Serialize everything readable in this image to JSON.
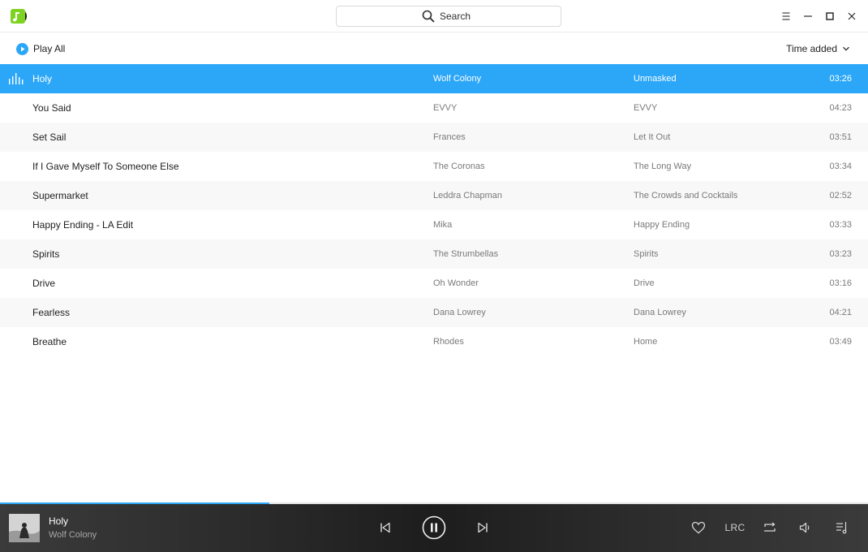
{
  "app": {
    "logo_icon": "music-note-logo-icon"
  },
  "search": {
    "placeholder": "Search",
    "icon": "search-icon"
  },
  "window_controls": [
    "menu-icon",
    "minimize-icon",
    "maximize-icon",
    "close-icon"
  ],
  "toolbar": {
    "play_all_label": "Play All",
    "sort_label": "Time added"
  },
  "songs": [
    {
      "title": "Holy",
      "artist": "Wolf Colony",
      "album": "Unmasked",
      "duration": "03:26",
      "playing": true
    },
    {
      "title": "You Said",
      "artist": "EVVY",
      "album": "EVVY",
      "duration": "04:23"
    },
    {
      "title": "Set Sail",
      "artist": "Frances",
      "album": "Let It Out",
      "duration": "03:51"
    },
    {
      "title": "If I Gave Myself To Someone Else",
      "artist": "The Coronas",
      "album": "The Long Way",
      "duration": "03:34"
    },
    {
      "title": "Supermarket",
      "artist": "Leddra Chapman",
      "album": "The Crowds and Cocktails",
      "duration": "02:52"
    },
    {
      "title": "Happy Ending - LA Edit",
      "artist": "Mika",
      "album": "Happy Ending",
      "duration": "03:33"
    },
    {
      "title": "Spirits",
      "artist": "The Strumbellas",
      "album": "Spirits",
      "duration": "03:23"
    },
    {
      "title": "Drive",
      "artist": "Oh Wonder",
      "album": "Drive",
      "duration": "03:16"
    },
    {
      "title": "Fearless",
      "artist": "Dana Lowrey",
      "album": "Dana Lowrey",
      "duration": "04:21"
    },
    {
      "title": "Breathe",
      "artist": "Rhodes",
      "album": "Home",
      "duration": "03:49"
    }
  ],
  "player": {
    "title": "Holy",
    "artist": "Wolf Colony",
    "progress": 0.31,
    "lrc_label": "LRC",
    "controls": [
      "previous-icon",
      "pause-icon",
      "next-icon",
      "heart-icon",
      "repeat-icon",
      "volume-icon",
      "playlist-icon"
    ]
  },
  "colors": {
    "accent": "#2ca7f8",
    "logo_green": "#7ed321",
    "footer_bg": "#2a2a2a"
  }
}
